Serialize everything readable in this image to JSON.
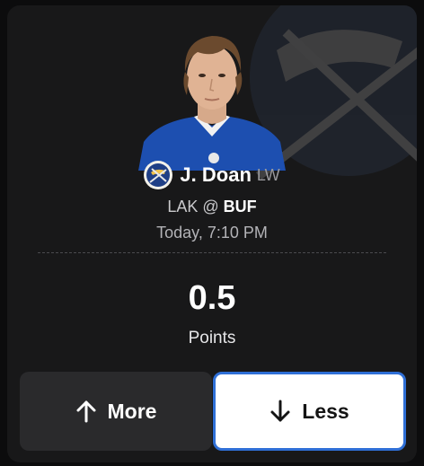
{
  "player": {
    "name": "J. Doan",
    "position": "LW"
  },
  "game": {
    "away_team": "LAK",
    "separator": "@",
    "home_team": "BUF",
    "time": "Today, 7:10 PM"
  },
  "projection": {
    "value": "0.5",
    "stat": "Points"
  },
  "buttons": {
    "more_label": "More",
    "less_label": "Less",
    "selected": "less"
  },
  "icons": {
    "team_logo": "buffalo-sabres-logo-icon",
    "more": "arrow-up-icon",
    "less": "arrow-down-icon",
    "watermark": "team-watermark-icon"
  },
  "colors": {
    "card_bg": "#181819",
    "more_bg": "#2a2a2c",
    "less_bg": "#ffffff",
    "selected_border": "#2f6fd6",
    "sabres_blue": "#1f3f86",
    "jersey_blue": "#1d4fb0"
  }
}
